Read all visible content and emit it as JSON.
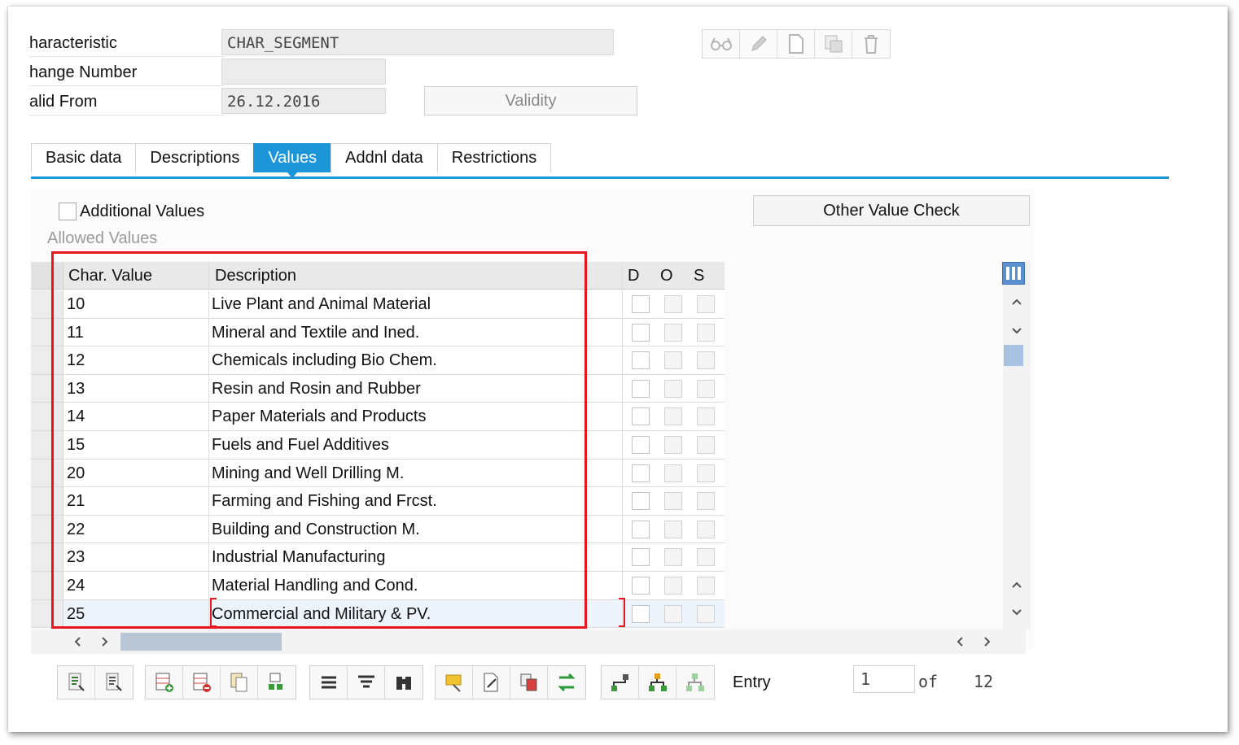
{
  "header": {
    "characteristic_label": "haracteristic",
    "characteristic_value": "CHAR_SEGMENT",
    "change_number_label": "hange Number",
    "change_number_value": "",
    "valid_from_label": "alid From",
    "valid_from_value": "26.12.2016",
    "validity_button": "Validity",
    "toolbar_icons": [
      "glasses-icon",
      "pencil-icon",
      "new-document-icon",
      "copy-icon",
      "trash-icon"
    ]
  },
  "tabs": [
    {
      "label": "Basic data",
      "active": false
    },
    {
      "label": "Descriptions",
      "active": false
    },
    {
      "label": "Values",
      "active": true
    },
    {
      "label": "Addnl data",
      "active": false
    },
    {
      "label": "Restrictions",
      "active": false
    }
  ],
  "values_panel": {
    "additional_values_label": "Additional Values",
    "additional_values_checked": false,
    "other_value_check_button": "Other Value Check",
    "allowed_values_title": "Allowed Values"
  },
  "table": {
    "columns": {
      "char_value": "Char. Value",
      "description": "Description",
      "d": "D",
      "o": "O",
      "s": "S"
    },
    "rows": [
      {
        "value": "10",
        "description": "Live Plant and Animal Material"
      },
      {
        "value": "11",
        "description": "Mineral and Textile and Ined."
      },
      {
        "value": "12",
        "description": "Chemicals including Bio Chem."
      },
      {
        "value": "13",
        "description": "Resin and Rosin and Rubber"
      },
      {
        "value": "14",
        "description": "Paper Materials and Products"
      },
      {
        "value": "15",
        "description": "Fuels and Fuel Additives"
      },
      {
        "value": "20",
        "description": "Mining and Well Drilling M."
      },
      {
        "value": "21",
        "description": "Farming and Fishing and Frcst."
      },
      {
        "value": "22",
        "description": "Building and Construction M."
      },
      {
        "value": "23",
        "description": "Industrial Manufacturing"
      },
      {
        "value": "24",
        "description": "Material Handling and Cond."
      },
      {
        "value": "25",
        "description": "Commercial and Military & PV."
      }
    ]
  },
  "bottom_toolbar_icons": [
    [
      "details-icon",
      "detail-list-icon"
    ],
    [
      "insert-row-icon",
      "delete-row-icon",
      "copy-rows-icon",
      "select-block-icon"
    ],
    [
      "align-icon",
      "filter-icon",
      "find-icon"
    ],
    [
      "note-icon",
      "edit-doc-icon",
      "compare-icon",
      "sort-icon"
    ],
    [
      "hierarchy-icon",
      "tree-icon",
      "org-icon"
    ]
  ],
  "entry": {
    "label": "Entry",
    "current": "1",
    "of_label": "of",
    "total": "12"
  },
  "colors": {
    "accent": "#1d95d9",
    "highlight": "#e5161d"
  }
}
